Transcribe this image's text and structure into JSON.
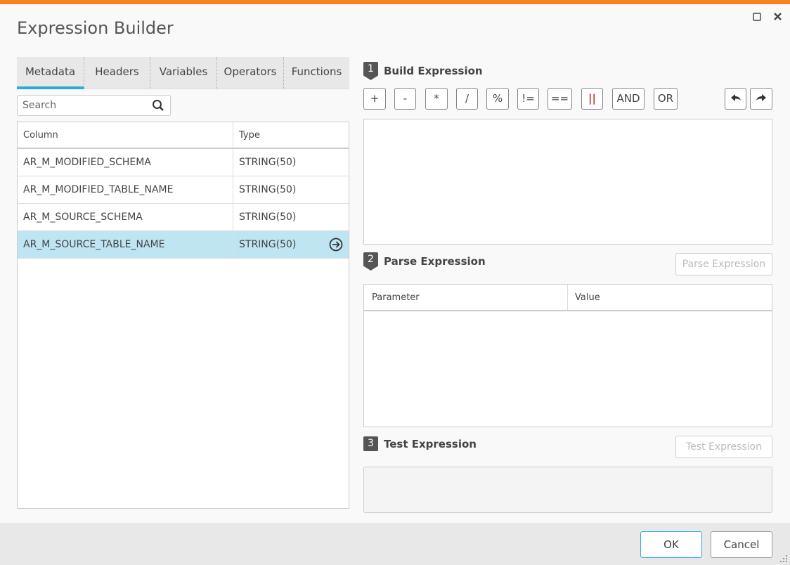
{
  "window": {
    "title": "Expression Builder",
    "maximize_icon": "square-icon",
    "close_icon": "close-icon"
  },
  "tabs": [
    "Metadata",
    "Headers",
    "Variables",
    "Operators",
    "Functions"
  ],
  "search": {
    "placeholder": "Search",
    "value": ""
  },
  "grid": {
    "headers": {
      "column": "Column",
      "type": "Type"
    },
    "rows": [
      {
        "column": "AR_M_MODIFIED_SCHEMA",
        "type": "STRING(50)"
      },
      {
        "column": "AR_M_MODIFIED_TABLE_NAME",
        "type": "STRING(50)"
      },
      {
        "column": "AR_M_SOURCE_SCHEMA",
        "type": "STRING(50)"
      },
      {
        "column": "AR_M_SOURCE_TABLE_NAME",
        "type": "STRING(50)",
        "selected": true
      }
    ]
  },
  "build": {
    "number": "1",
    "title": "Build Expression",
    "operators": [
      "+",
      "-",
      "*",
      "/",
      "%",
      "!=",
      "==",
      "||",
      "AND",
      "OR"
    ],
    "expression": ""
  },
  "parse": {
    "number": "2",
    "title": "Parse Expression",
    "button": "Parse Expression",
    "headers": {
      "parameter": "Parameter",
      "value": "Value"
    }
  },
  "test": {
    "number": "3",
    "title": "Test Expression",
    "button": "Test Expression",
    "result": ""
  },
  "footer": {
    "ok": "OK",
    "cancel": "Cancel"
  },
  "colors": {
    "accent": "#f5841f",
    "tab_active": "#29abe2",
    "selected_row": "#bfe5f3"
  }
}
